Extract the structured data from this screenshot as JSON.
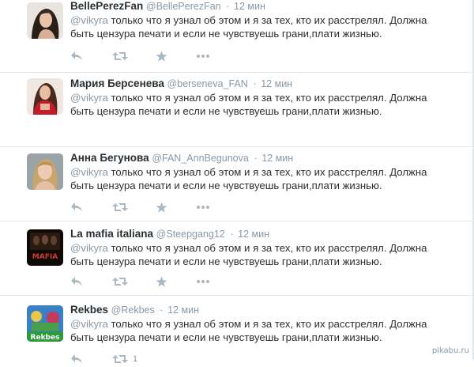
{
  "tweets": [
    {
      "name": "BellePerezFan",
      "handle": "@BellePerezFan",
      "dot": "·",
      "time": "12 мин",
      "mention": "@vikyra",
      "line1": " только что я узнал об этом и я за тех, кто их расстрелял. Должна",
      "line2": "быть цензура печати и если не чувствуешь грани,плати жизнью.",
      "avatar_icon": "portrait-dark-hair",
      "retweet_count": ""
    },
    {
      "name": "Мария Берсенева",
      "handle": "@berseneva_FAN",
      "dot": "·",
      "time": "12 мин",
      "mention": "@vikyra",
      "line1": " только что я узнал об этом и я за тех, кто их расстрелял. Должна",
      "line2": "быть цензура печати и если не чувствуешь грани,плати жизнью.",
      "avatar_icon": "portrait-red-outfit",
      "retweet_count": ""
    },
    {
      "name": "Анна Бегунова",
      "handle": "@FAN_AnnBegunova",
      "dot": "·",
      "time": "12 мин",
      "mention": "@vikyra",
      "line1": " только что я узнал об этом и я за тех, кто их расстрелял. Должна",
      "line2": "быть цензура печати и если не чувствуешь грани,плати жизнью.",
      "avatar_icon": "portrait-blonde",
      "retweet_count": ""
    },
    {
      "name": "La mafia italiana",
      "handle": "@Steepgang12",
      "dot": "·",
      "time": "12 мин",
      "mention": "@vikyra",
      "line1": " только что я узнал об этом и я за тех, кто их расстрелял. Должна",
      "line2": "быть цензура печати и если не чувствуешь грани,плати жизнью.",
      "avatar_icon": "mafia-logo",
      "avatar_text": "MAFIA",
      "retweet_count": ""
    },
    {
      "name": "Rekbes",
      "handle": "@Rekbes",
      "dot": "·",
      "time": "12 мин",
      "mention": "@vikyra",
      "line1": " только что я узнал об этом и я за тех, кто их расстрелял. Должна",
      "line2": "быть цензура печати и если не чувствуешь грани,плати жизнью.",
      "avatar_icon": "rekbes-logo",
      "avatar_text": "Rekbes",
      "retweet_count": "1"
    }
  ],
  "watermark": "pikabu.ru",
  "colors": {
    "secondary": "#8899a6",
    "text": "#292f33",
    "icon": "#aab8c2",
    "divider": "#e1e8ed"
  },
  "icons": [
    "reply-icon",
    "retweet-icon",
    "favorite-icon",
    "more-icon"
  ]
}
